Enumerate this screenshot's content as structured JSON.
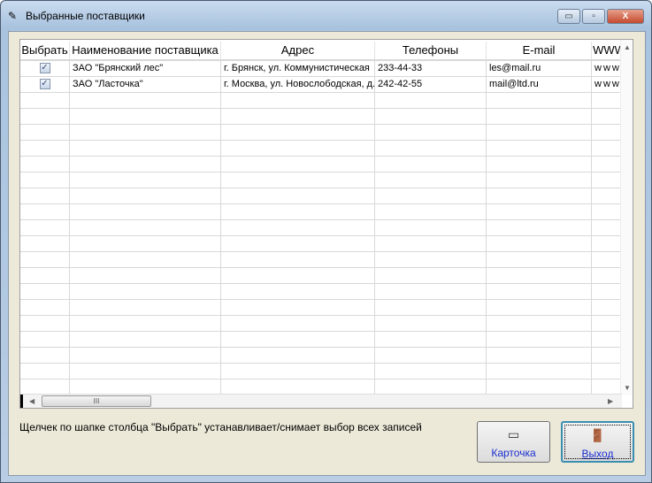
{
  "window": {
    "title": "Выбранные поставщики",
    "minimize": "▭",
    "maximize": "▫",
    "close": "X"
  },
  "grid": {
    "columns": [
      "Выбрать",
      "Наименование поставщика",
      "Адрес",
      "Телефоны",
      "E-mail",
      "WWW"
    ],
    "rows": [
      {
        "checked": true,
        "name": "ЗАО \"Брянский лес\"",
        "address": "г. Брянск, ул. Коммунистическая",
        "phone": "233-44-33",
        "email": "les@mail.ru",
        "www": "www"
      },
      {
        "checked": true,
        "name": "ЗАО \"Ласточка\"",
        "address": "г. Москва, ул. Новослободская, д.",
        "phone": "242-42-55",
        "email": "mail@ltd.ru",
        "www": "www"
      }
    ],
    "empty_rows": 19
  },
  "hint": "Щелчек по шапке столбца \"Выбрать\" устанавливает/снимает выбор всех записей",
  "buttons": {
    "card": "Карточка",
    "exit": "Выход"
  }
}
